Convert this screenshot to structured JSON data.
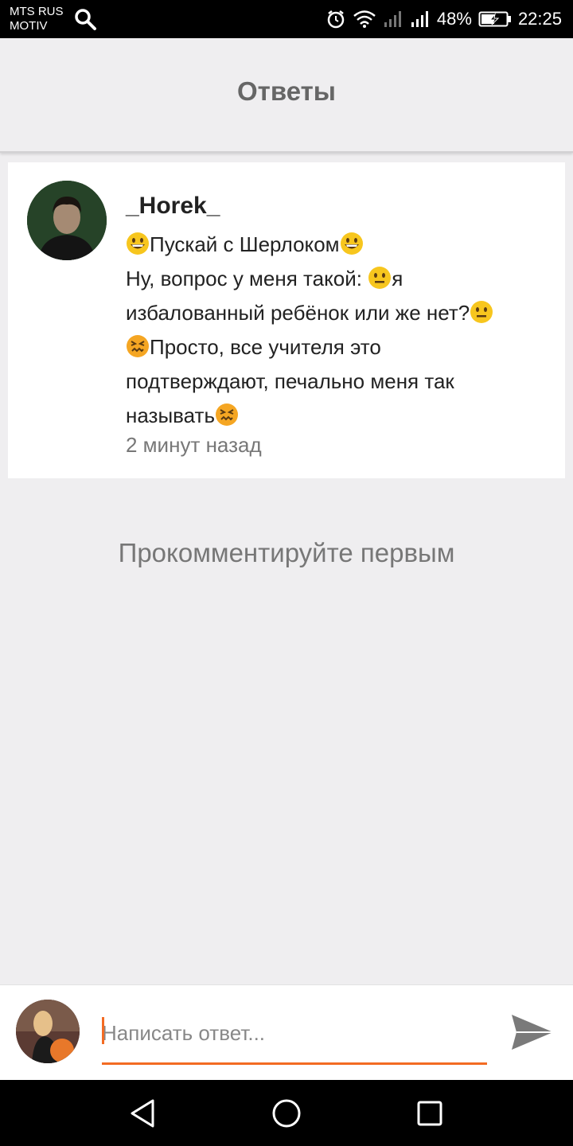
{
  "status_bar": {
    "carrier_line1": "MTS RUS",
    "carrier_line2": "MOTIV",
    "battery": "48%",
    "time": "22:25",
    "icons": [
      "search-icon",
      "alarm-icon",
      "wifi-icon",
      "signal-icon",
      "signal-icon",
      "battery-charging-icon"
    ]
  },
  "header": {
    "title": "Ответы"
  },
  "post": {
    "author": "_Horek_",
    "lines": [
      {
        "before_icon": "grinning-emoji",
        "text": "Пускай с Шерлоком",
        "after_icon": "grinning-emoji"
      },
      {
        "text": "Ну, вопрос у меня такой: ",
        "after_icon": "neutral-emoji",
        "tail": "я"
      },
      {
        "text": "избалованный ребёнок или же нет?",
        "after_icon": "neutral-emoji"
      },
      {
        "before_icon": "confounded-emoji",
        "text": "Просто, все учителя это"
      },
      {
        "text": "подтверждают, печально меня так"
      },
      {
        "text": "называть",
        "after_icon": "confounded-emoji"
      }
    ],
    "time": "2 минут назад"
  },
  "empty_state": "Прокомментируйте первым",
  "reply": {
    "placeholder": "Написать ответ...",
    "value": ""
  },
  "colors": {
    "accent": "#f36b23",
    "background": "#efeef0",
    "send_icon": "#7a7a7a"
  },
  "nav_icons": [
    "back-icon",
    "home-icon",
    "recents-icon"
  ]
}
